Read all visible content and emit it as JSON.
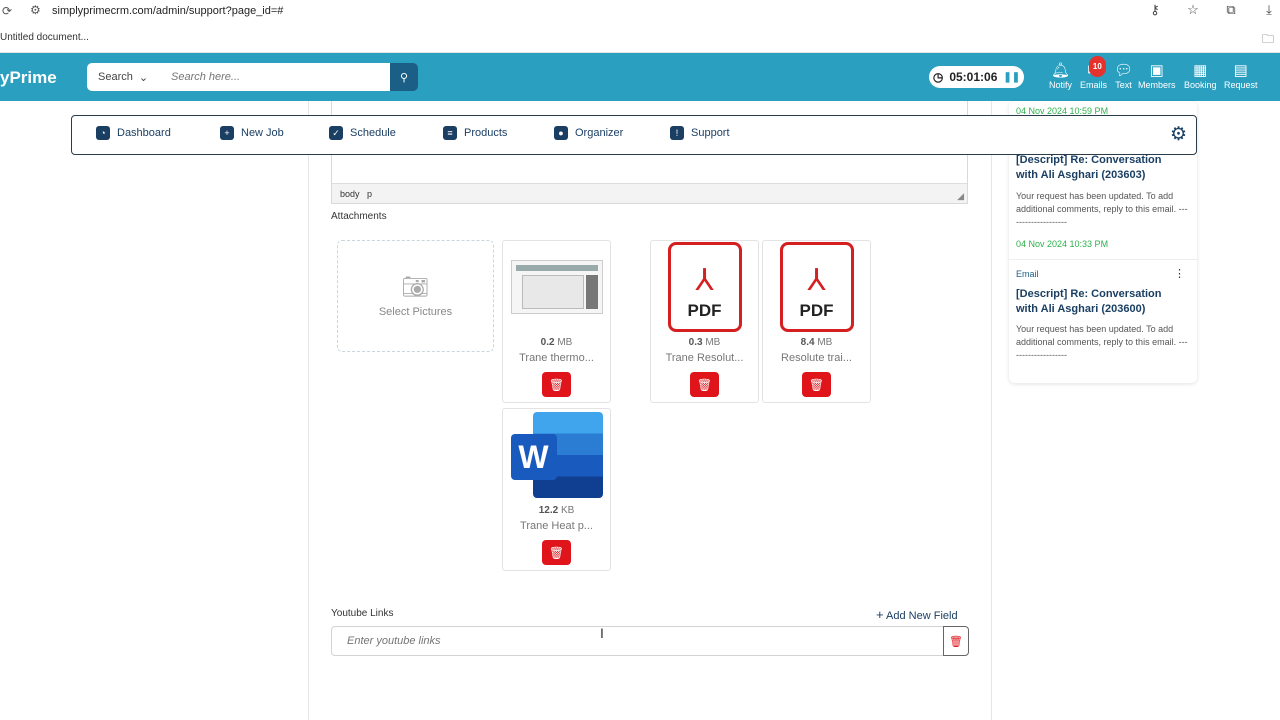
{
  "browser": {
    "url": "simplyprimecrm.com/admin/support?page_id=#",
    "bookmark": "Untitled document..."
  },
  "header": {
    "brand": "yPrime",
    "search_select": "Search",
    "search_placeholder": "Search here...",
    "timer": "05:01:06",
    "nav": [
      {
        "label": "Notify",
        "icon": "bell-icon"
      },
      {
        "label": "Emails",
        "icon": "mail-icon",
        "badge": "10"
      },
      {
        "label": "Text",
        "icon": "chat-icon"
      },
      {
        "label": "Members",
        "icon": "members-icon"
      },
      {
        "label": "Booking",
        "icon": "calendar-icon"
      },
      {
        "label": "Request",
        "icon": "request-icon"
      }
    ]
  },
  "mainnav": [
    {
      "label": "Dashboard",
      "icon": "dashboard-icon"
    },
    {
      "label": "New Job",
      "icon": "user-plus-icon"
    },
    {
      "label": "Schedule",
      "icon": "schedule-icon"
    },
    {
      "label": "Products",
      "icon": "database-icon"
    },
    {
      "label": "Organizer",
      "icon": "organizer-icon"
    },
    {
      "label": "Support",
      "icon": "bulb-icon"
    }
  ],
  "editor": {
    "path_body": "body",
    "path_p": "p"
  },
  "attachments": {
    "label": "Attachments",
    "picker_label": "Select Pictures",
    "files": [
      {
        "size_num": "0.2",
        "size_unit": "MB",
        "name": "Trane thermo...",
        "kind": "image"
      },
      {
        "size_num": "0.3",
        "size_unit": "MB",
        "name": "Trane Resolut...",
        "kind": "pdf"
      },
      {
        "size_num": "8.4",
        "size_unit": "MB",
        "name": "Resolute trai...",
        "kind": "pdf"
      },
      {
        "size_num": "12.2",
        "size_unit": "KB",
        "name": "Trane Heat p...",
        "kind": "word"
      }
    ],
    "pdf_text": "PDF",
    "word_letter": "W"
  },
  "youtube": {
    "label": "Youtube Links",
    "add_label": "Add New Field",
    "placeholder": "Enter youtube links"
  },
  "sidebar": {
    "top_date": "04 Nov 2024 10:59 PM",
    "items": [
      {
        "type": "",
        "title": "[Descript] Re: Conversation with Ali Asghari (203603)",
        "body": "Your request has been updated. To add additional comments, reply to this email. --------------------",
        "date": "04 Nov 2024 10:33 PM"
      },
      {
        "type": "Email",
        "title": "[Descript] Re: Conversation with Ali Asghari (203600)",
        "body": "Your request has been updated. To add additional comments, reply to this email. --------------------",
        "date": ""
      }
    ]
  }
}
